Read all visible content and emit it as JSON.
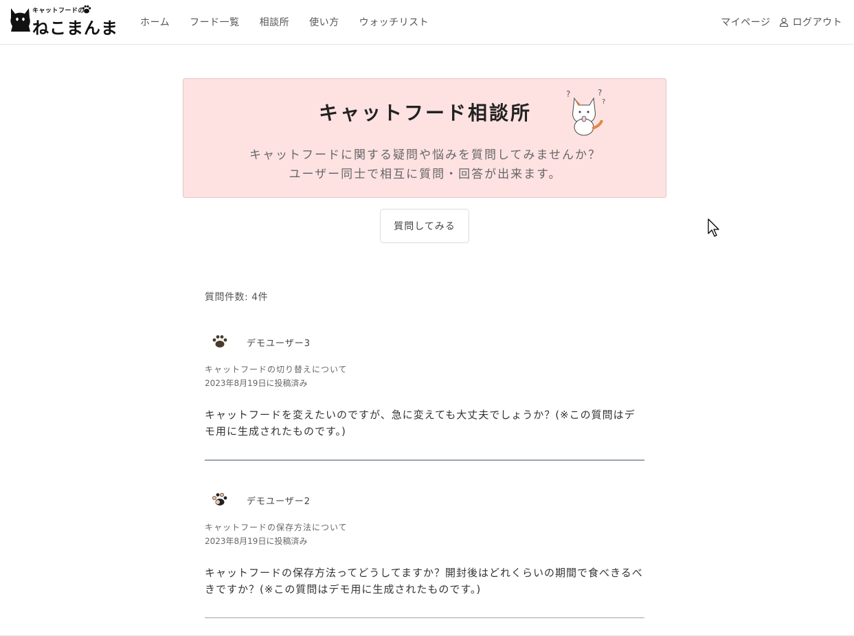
{
  "header": {
    "logo_tagline": "キャットフードの",
    "logo_brand": "ねこまんま",
    "nav": [
      {
        "label": "ホーム"
      },
      {
        "label": "フード一覧"
      },
      {
        "label": "相談所"
      },
      {
        "label": "使い方"
      },
      {
        "label": "ウォッチリスト"
      }
    ],
    "mypage_label": "マイページ",
    "logout_label": "ログアウト"
  },
  "banner": {
    "title": "キャットフード相談所",
    "subtitle_line1": "キャットフードに関する疑問や悩みを質問してみませんか？",
    "subtitle_line2": "ユーザー同士で相互に質問・回答が出来ます。",
    "background": "#fee2e2"
  },
  "ask_button_label": "質問してみる",
  "question_count_label": "質問件数: 4件",
  "questions": [
    {
      "user": "デモユーザー3",
      "title": "キャットフードの切り替えについて",
      "date": "2023年8月19日に投稿済み",
      "body": "キャットフードを変えたいのですが、急に変えても大丈夫でしょうか？(※この質問はデモ用に生成されたものです。)",
      "avatar_icon": "paw-icon"
    },
    {
      "user": "デモユーザー2",
      "title": "キャットフードの保存方法について",
      "date": "2023年8月19日に投稿済み",
      "body": "キャットフードの保存方法ってどうしてますか？開封後はどれくらいの期間で食べきるべきですか？(※この質問はデモ用に生成されたものです。)",
      "avatar_icon": "calico-paw-icon"
    }
  ]
}
